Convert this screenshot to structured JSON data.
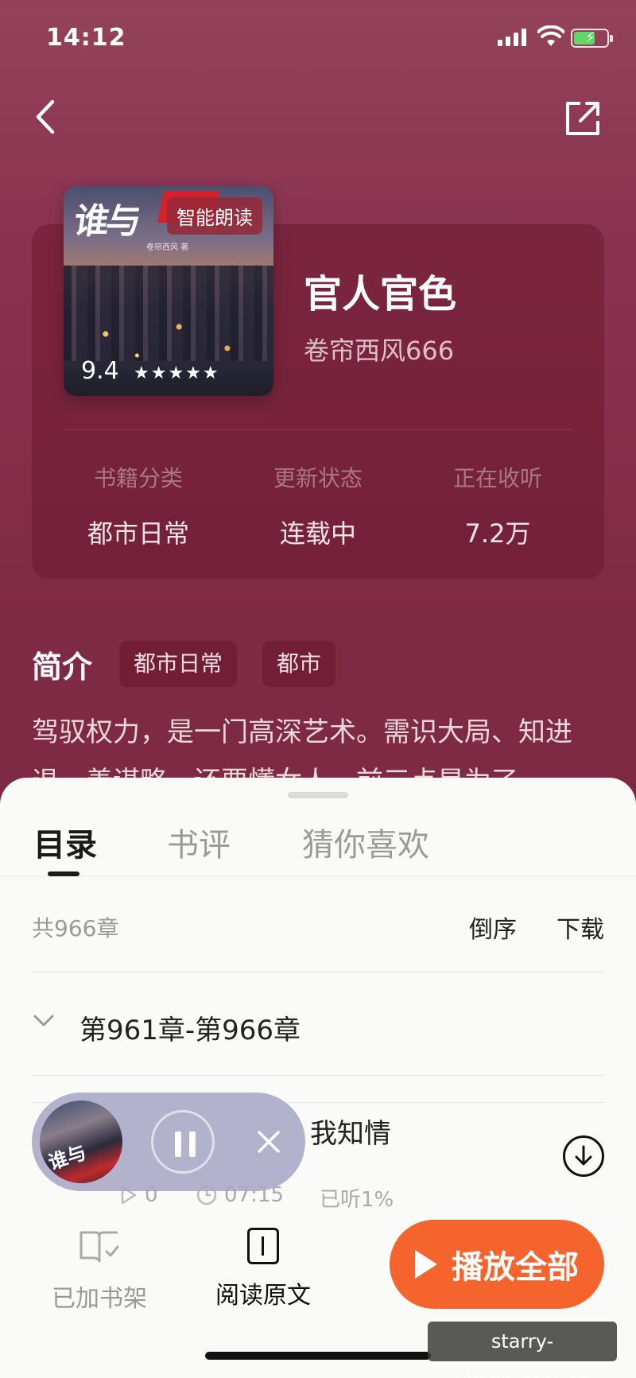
{
  "status_bar": {
    "time": "14:12"
  },
  "book": {
    "cover_badge": "智能朗读",
    "rating": "9.4",
    "stars": "★★★★★",
    "title": "官人官色",
    "author": "卷帘西风666"
  },
  "stats": [
    {
      "label": "书籍分类",
      "value": "都市日常"
    },
    {
      "label": "更新状态",
      "value": "连载中"
    },
    {
      "label": "正在收听",
      "value": "7.2万"
    }
  ],
  "intro": {
    "title": "简介",
    "tags": [
      "都市日常",
      "都市"
    ],
    "text": "驾驭权力，是一门高深艺术。需识大局、知进退、善谋略，还要懂女人。前三点是为了"
  },
  "sheet": {
    "tabs": [
      "目录",
      "书评",
      "猜你喜欢"
    ],
    "active_tab": "目录",
    "chapter_count": "共966章",
    "order_label": "倒序",
    "download_label": "下载",
    "group_label": "第961章-第966章",
    "chapter": {
      "title": "我知情",
      "plays": "0",
      "duration": "07:15",
      "progress": "已听1%"
    }
  },
  "bottom_bar": {
    "shelf_label": "已加书架",
    "read_label": "阅读原文",
    "play_all_label": "播放全部"
  },
  "watermark": "starry-xkapp.com.cn",
  "colors": {
    "accent": "#f4642c",
    "background": "#7e2a44",
    "sheet": "#fafaf9"
  }
}
